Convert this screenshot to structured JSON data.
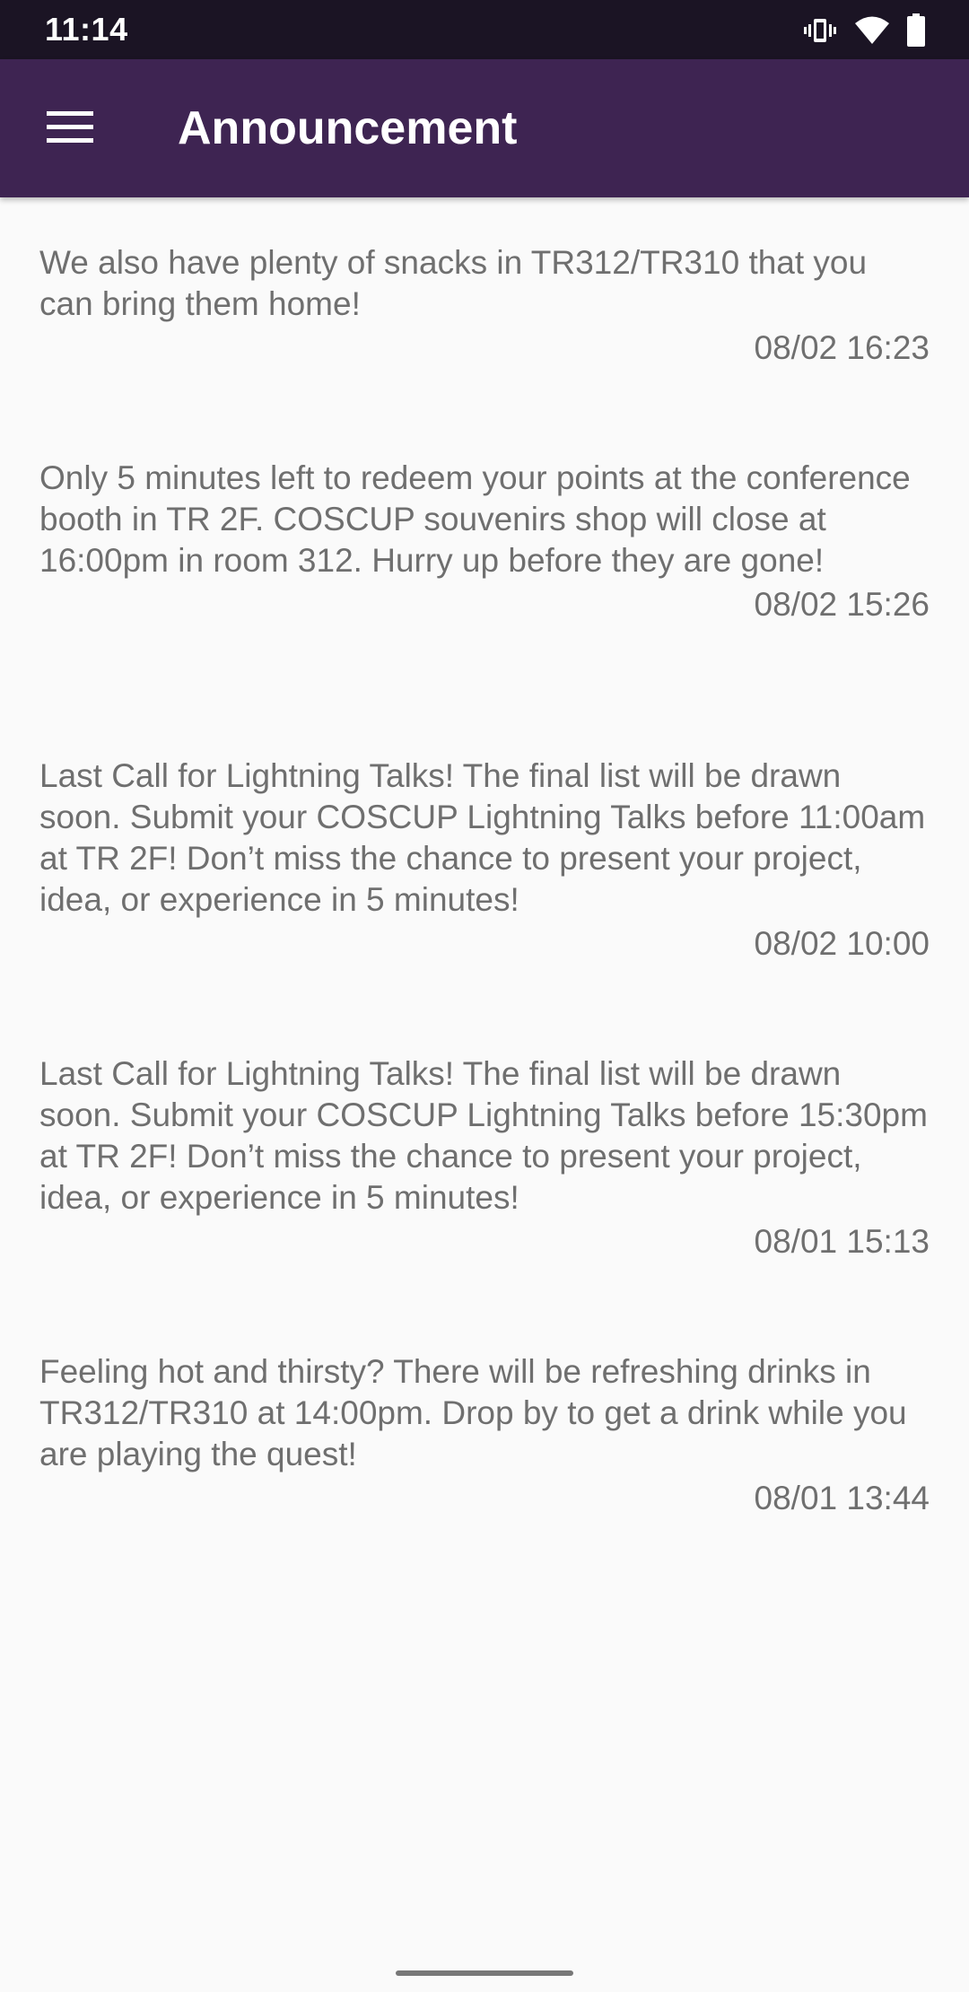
{
  "status_bar": {
    "time": "11:14",
    "icons": [
      "vibrate-icon",
      "wifi-icon",
      "battery-icon"
    ]
  },
  "app_bar": {
    "title": "Announcement",
    "menu_icon": "hamburger-menu-icon",
    "background": "#3e2452"
  },
  "announcements": [
    {
      "text": "We also have plenty of snacks in TR312/TR310 that you can bring them home!",
      "time": "08/02 16:23"
    },
    {
      "text": "Only 5 minutes left to redeem your points at the conference booth in TR 2F. COSCUP souvenirs shop will close at 16:00pm in room 312. Hurry up before they are gone!",
      "time": "08/02 15:26"
    },
    {
      "text": "Last Call for Lightning Talks! The final list will be drawn soon. Submit your COSCUP Lightning Talks before 11:00am at TR 2F! Don’t miss the chance to present your project, idea, or experience in 5 minutes!",
      "time": "08/02 10:00"
    },
    {
      "text": "Last Call for Lightning Talks! The final list will be drawn soon. Submit your COSCUP Lightning Talks before 15:30pm at TR 2F! Don’t miss the chance to present your project, idea, or experience in 5 minutes!",
      "time": "08/01 15:13"
    },
    {
      "text": "Feeling hot and thirsty? There will be refreshing drinks in TR312/TR310 at 14:00pm. Drop by to get a drink while you are playing the quest!",
      "time": "08/01 13:44"
    }
  ]
}
